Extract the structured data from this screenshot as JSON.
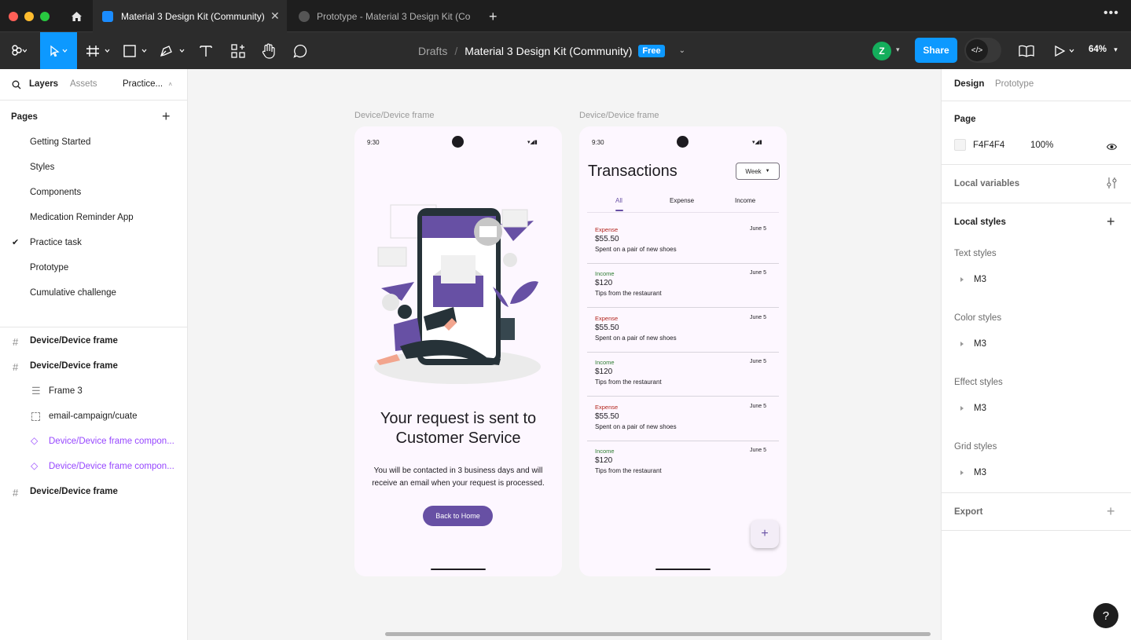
{
  "tabs": [
    {
      "label": "Material 3 Design Kit (Community)"
    },
    {
      "label": "Prototype - Material 3 Design Kit (Co"
    }
  ],
  "toolbar": {
    "breadcrumb_drafts": "Drafts",
    "breadcrumb_sep": "/",
    "file_name": "Material 3 Design Kit (Community)",
    "plan_badge": "Free",
    "avatar_letter": "Z",
    "share_label": "Share",
    "zoom": "64%"
  },
  "left": {
    "tab_layers": "Layers",
    "tab_assets": "Assets",
    "page_dropdown": "Practice...",
    "pages_title": "Pages",
    "pages": [
      "Getting Started",
      "Styles",
      "Components",
      "Medication Reminder App",
      "Practice task",
      "Prototype",
      "Cumulative challenge"
    ],
    "layers": [
      {
        "label": "Device/Device frame"
      },
      {
        "label": "Device/Device frame"
      },
      {
        "label": "Frame 3"
      },
      {
        "label": "email-campaign/cuate"
      },
      {
        "label": "Device/Device frame compon..."
      },
      {
        "label": "Device/Device frame compon..."
      },
      {
        "label": "Device/Device frame"
      }
    ]
  },
  "canvas": {
    "frame1_label": "Device/Device frame",
    "frame2_label": "Device/Device frame",
    "phone1": {
      "time": "9:30",
      "headline": "Your request is sent to Customer Service",
      "body": "You will be contacted in 3 business days and will receive an email when your request is processed.",
      "button": "Back to Home"
    },
    "phone2": {
      "time": "9:30",
      "title": "Transactions",
      "period": "Week",
      "tabs": [
        "All",
        "Expense",
        "Income"
      ],
      "transactions": [
        {
          "type": "Expense",
          "date": "June 5",
          "amount": "$55.50",
          "note": "Spent on a pair of new shoes"
        },
        {
          "type": "Income",
          "date": "June 5",
          "amount": "$120",
          "note": "Tips from the restaurant"
        },
        {
          "type": "Expense",
          "date": "June 5",
          "amount": "$55.50",
          "note": "Spent on a pair of new shoes"
        },
        {
          "type": "Income",
          "date": "June 5",
          "amount": "$120",
          "note": "Tips from the restaurant"
        },
        {
          "type": "Expense",
          "date": "June 5",
          "amount": "$55.50",
          "note": "Spent on a pair of new shoes"
        },
        {
          "type": "Income",
          "date": "June 5",
          "amount": "$120",
          "note": "Tips from the restaurant"
        }
      ],
      "fab": "+"
    }
  },
  "right": {
    "tab_design": "Design",
    "tab_prototype": "Prototype",
    "page_title": "Page",
    "page_color": "F4F4F4",
    "page_opacity": "100%",
    "local_variables": "Local variables",
    "local_styles": "Local styles",
    "text_styles": "Text styles",
    "color_styles": "Color styles",
    "effect_styles": "Effect styles",
    "grid_styles": "Grid styles",
    "m3": "M3",
    "export": "Export",
    "help": "?"
  },
  "colors": {
    "accent": "#0d99ff",
    "purple": "#6750a4",
    "expense": "#b3261e",
    "income": "#2e7d32",
    "component": "#9747ff"
  }
}
